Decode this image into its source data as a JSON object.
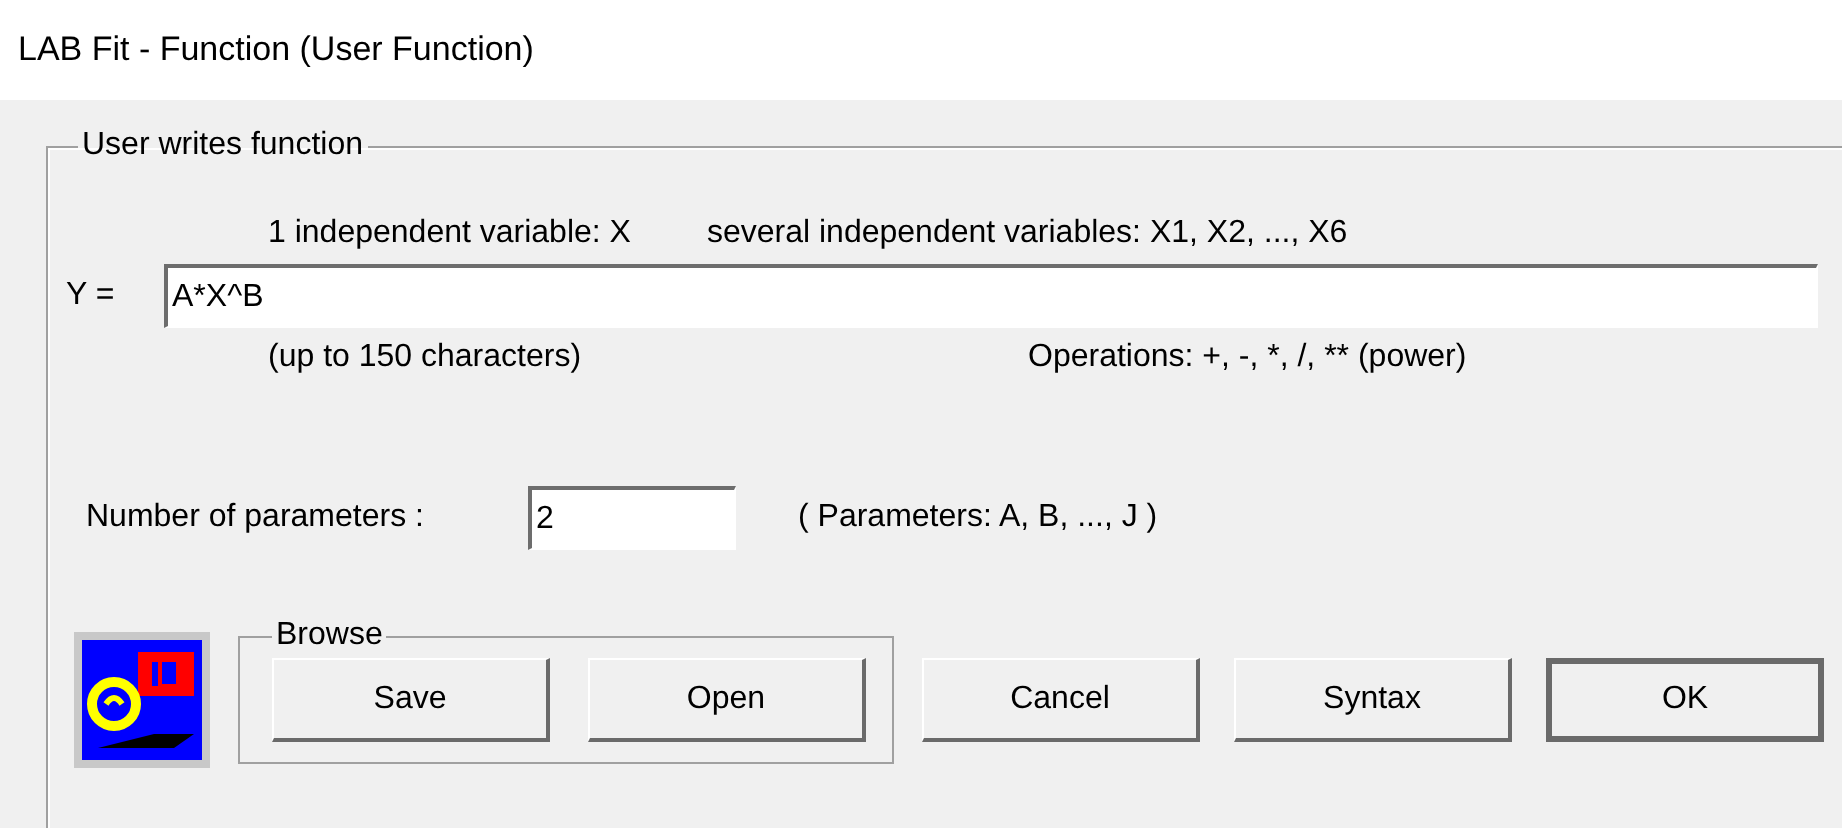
{
  "window": {
    "title": "LAB Fit - Function (User Function)"
  },
  "group": {
    "legend": "User writes function",
    "hint_single": "1 independent variable: X",
    "hint_several": "several independent variables: X1, X2, ..., X6",
    "y_label": "Y =",
    "function_value": "A*X^B",
    "limit_note": "(up to 150 characters)",
    "operations_note": "Operations:  +,  -,  *,  /,  ** (power)",
    "params_label": "Number of parameters :",
    "params_value": "2",
    "params_note": "( Parameters:  A,  B,  ...,  J )"
  },
  "browse": {
    "legend": "Browse",
    "buttons": [
      "Save",
      "Open"
    ]
  },
  "buttons": [
    {
      "label": "Cancel",
      "default": false
    },
    {
      "label": "Syntax",
      "default": false
    },
    {
      "label": "OK",
      "default": true
    }
  ]
}
